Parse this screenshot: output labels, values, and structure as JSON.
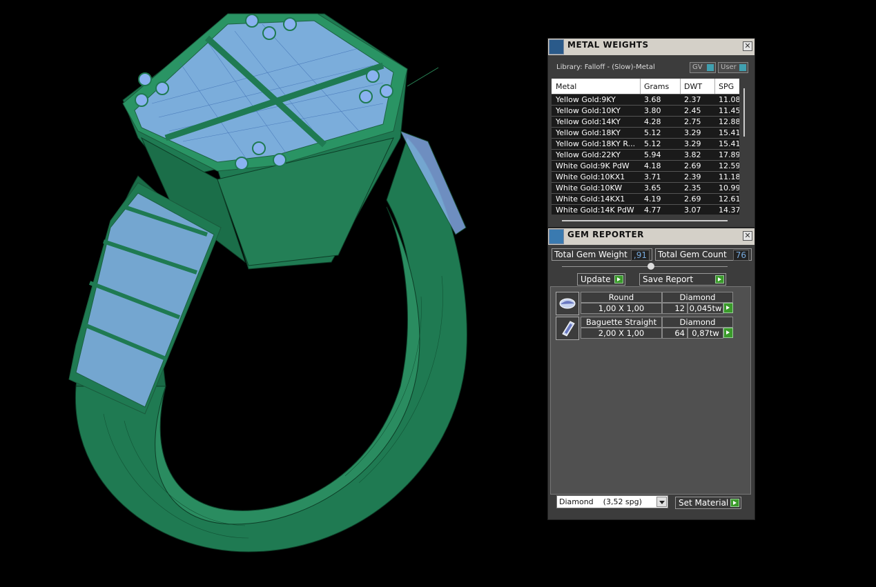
{
  "metal_weights": {
    "title": "METAL WEIGHTS",
    "library": "Library: Falloff - (Slow)-Metal",
    "gv_label": "GV",
    "user_label": "User",
    "columns": [
      "Metal",
      "Grams",
      "DWT",
      "SPG"
    ],
    "rows": [
      [
        "Yellow Gold:9KY",
        "3.68",
        "2.37",
        "11.08"
      ],
      [
        "Yellow Gold:10KY",
        "3.80",
        "2.45",
        "11.45"
      ],
      [
        "Yellow Gold:14KY",
        "4.28",
        "2.75",
        "12.88"
      ],
      [
        "Yellow Gold:18KY",
        "5.12",
        "3.29",
        "15.41"
      ],
      [
        "Yellow Gold:18KY R...",
        "5.12",
        "3.29",
        "15.41"
      ],
      [
        "Yellow Gold:22KY",
        "5.94",
        "3.82",
        "17.89"
      ],
      [
        "White Gold:9K PdW",
        "4.18",
        "2.69",
        "12.59"
      ],
      [
        "White Gold:10KX1",
        "3.71",
        "2.39",
        "11.18"
      ],
      [
        "White Gold:10KW",
        "3.65",
        "2.35",
        "10.99"
      ],
      [
        "White Gold:14KX1",
        "4.19",
        "2.69",
        "12.61"
      ],
      [
        "White Gold:14K PdW",
        "4.77",
        "3.07",
        "14.37"
      ]
    ]
  },
  "gem_reporter": {
    "title": "GEM REPORTER",
    "total_weight_label": "Total Gem Weight",
    "total_weight": ",91",
    "total_count_label": "Total Gem Count",
    "total_count": "76",
    "update_label": "Update",
    "save_report_label": "Save Report",
    "gems": [
      {
        "shape": "Round",
        "material": "Diamond",
        "size": "1,00 X 1,00",
        "count": "12",
        "weight": "0,045tw"
      },
      {
        "shape": "Baguette Straight",
        "material": "Diamond",
        "size": "2,00 X 1,00",
        "count": "64",
        "weight": "0,87tw"
      }
    ],
    "material_select": "Diamond    (3,52 spg)",
    "set_material_label": "Set Material"
  },
  "colors": {
    "ring_green": "#1f7a52",
    "gem_blue": "#8ab2f0",
    "panel_bg": "#3c3c3c"
  }
}
